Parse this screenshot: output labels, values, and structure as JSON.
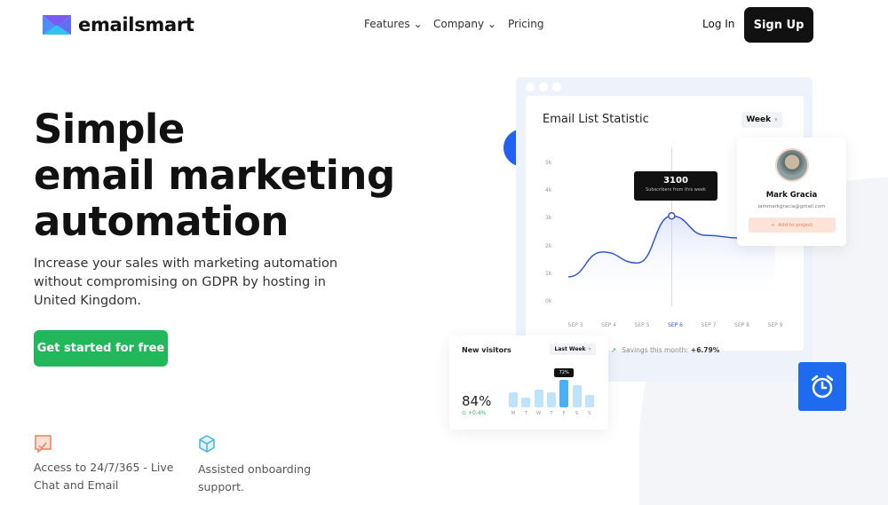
{
  "brand": {
    "name": "emailsmart"
  },
  "nav": {
    "features": "Features",
    "company": "Company",
    "pricing": "Pricing",
    "login": "Log In",
    "signup": "Sign Up"
  },
  "hero": {
    "title_lines": [
      "Simple",
      "email marketing",
      "automation"
    ],
    "description": "Increase your sales with marketing automation without compromising on GDPR by hosting in United Kingdom.",
    "cta": "Get started for free"
  },
  "features": [
    {
      "icon": "chat-check-icon",
      "text": "Access to 24/7/365 - Live Chat and Email",
      "color": "#e9805f"
    },
    {
      "icon": "cube-icon",
      "text": "Assisted onboarding support.",
      "color": "#4bb3e6"
    }
  ],
  "dashboard": {
    "title": "Email List Statistic",
    "period": "Week",
    "tooltip": {
      "value": "3100",
      "label": "Subscribers from this week"
    },
    "savings_label": "Savings this month:",
    "savings_value": "+6.79%"
  },
  "chart_data": {
    "type": "line",
    "categories": [
      "SEP 3",
      "SEP 4",
      "SEP 5",
      "SEP 6",
      "SEP 7",
      "SEP 8",
      "SEP 9"
    ],
    "y_ticks": [
      "5k",
      "4k",
      "3k",
      "2k",
      "1k",
      "0k"
    ],
    "ylim": [
      0,
      5000
    ],
    "values": [
      900,
      1800,
      1400,
      3100,
      2400,
      2300,
      2600
    ],
    "highlight": "SEP 6",
    "color": "#3356d6"
  },
  "profile": {
    "name": "Mark Gracia",
    "email": "iammarkgracia@gmail.com",
    "action": "Add to project"
  },
  "visitors": {
    "title": "New visitors",
    "period": "Last Week",
    "value": "84%",
    "change": "+0.4%",
    "bar_tooltip": "72%",
    "days": [
      "M",
      "T",
      "W",
      "T",
      "F",
      "S",
      "S"
    ],
    "levels": [
      0.55,
      0.35,
      0.65,
      0.55,
      1.0,
      0.8,
      0.45
    ],
    "active_index": 4
  }
}
